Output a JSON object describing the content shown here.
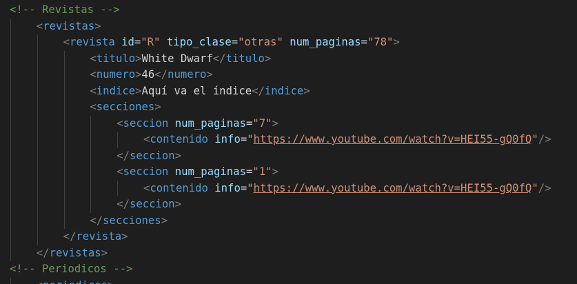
{
  "editor": {
    "language": "xml",
    "colors": {
      "background": "#1e1e1e",
      "comment": "#6a9955",
      "punctuation": "#808080",
      "tag": "#569cd6",
      "attribute": "#9cdcfe",
      "string": "#ce9178",
      "text": "#d4d4d4"
    },
    "lines": [
      {
        "indent": 0,
        "tokens": [
          {
            "k": "c",
            "v": "<!-- Revistas -->"
          }
        ]
      },
      {
        "indent": 1,
        "tokens": [
          {
            "k": "p",
            "v": "<"
          },
          {
            "k": "t",
            "v": "revistas"
          },
          {
            "k": "p",
            "v": ">"
          }
        ]
      },
      {
        "indent": 2,
        "tokens": [
          {
            "k": "p",
            "v": "<"
          },
          {
            "k": "t",
            "v": "revista"
          },
          {
            "k": "tx",
            "v": " "
          },
          {
            "k": "a",
            "v": "id"
          },
          {
            "k": "tx",
            "v": "="
          },
          {
            "k": "s",
            "v": "\"R\""
          },
          {
            "k": "tx",
            "v": " "
          },
          {
            "k": "a",
            "v": "tipo_clase"
          },
          {
            "k": "tx",
            "v": "="
          },
          {
            "k": "s",
            "v": "\"otras\""
          },
          {
            "k": "tx",
            "v": " "
          },
          {
            "k": "a",
            "v": "num_paginas"
          },
          {
            "k": "tx",
            "v": "="
          },
          {
            "k": "s",
            "v": "\"78\""
          },
          {
            "k": "p",
            "v": ">"
          }
        ]
      },
      {
        "indent": 3,
        "tokens": [
          {
            "k": "p",
            "v": "<"
          },
          {
            "k": "t",
            "v": "titulo"
          },
          {
            "k": "p",
            "v": ">"
          },
          {
            "k": "tx",
            "v": "White Dwarf"
          },
          {
            "k": "p",
            "v": "</"
          },
          {
            "k": "t",
            "v": "titulo"
          },
          {
            "k": "p",
            "v": ">"
          }
        ]
      },
      {
        "indent": 3,
        "tokens": [
          {
            "k": "p",
            "v": "<"
          },
          {
            "k": "t",
            "v": "numero"
          },
          {
            "k": "p",
            "v": ">"
          },
          {
            "k": "tx",
            "v": "46"
          },
          {
            "k": "p",
            "v": "</"
          },
          {
            "k": "t",
            "v": "numero"
          },
          {
            "k": "p",
            "v": ">"
          }
        ]
      },
      {
        "indent": 3,
        "tokens": [
          {
            "k": "p",
            "v": "<"
          },
          {
            "k": "t",
            "v": "indice"
          },
          {
            "k": "p",
            "v": ">"
          },
          {
            "k": "tx",
            "v": "Aquí va el índice"
          },
          {
            "k": "p",
            "v": "</"
          },
          {
            "k": "t",
            "v": "indice"
          },
          {
            "k": "p",
            "v": ">"
          }
        ]
      },
      {
        "indent": 3,
        "tokens": [
          {
            "k": "p",
            "v": "<"
          },
          {
            "k": "t",
            "v": "secciones"
          },
          {
            "k": "p",
            "v": ">"
          }
        ]
      },
      {
        "indent": 4,
        "tokens": [
          {
            "k": "p",
            "v": "<"
          },
          {
            "k": "t",
            "v": "seccion"
          },
          {
            "k": "tx",
            "v": " "
          },
          {
            "k": "a",
            "v": "num_paginas"
          },
          {
            "k": "tx",
            "v": "="
          },
          {
            "k": "s",
            "v": "\"7\""
          },
          {
            "k": "p",
            "v": ">"
          }
        ]
      },
      {
        "indent": 5,
        "tokens": [
          {
            "k": "p",
            "v": "<"
          },
          {
            "k": "t",
            "v": "contenido"
          },
          {
            "k": "tx",
            "v": " "
          },
          {
            "k": "a",
            "v": "info"
          },
          {
            "k": "tx",
            "v": "="
          },
          {
            "k": "s",
            "v": "\""
          },
          {
            "k": "lnk",
            "v": "https://www.youtube.com/watch?v=HEI55-gQ0fQ"
          },
          {
            "k": "s",
            "v": "\""
          },
          {
            "k": "p",
            "v": "/>"
          }
        ]
      },
      {
        "indent": 4,
        "tokens": [
          {
            "k": "p",
            "v": "</"
          },
          {
            "k": "t",
            "v": "seccion"
          },
          {
            "k": "p",
            "v": ">"
          }
        ]
      },
      {
        "indent": 4,
        "tokens": [
          {
            "k": "p",
            "v": "<"
          },
          {
            "k": "t",
            "v": "seccion"
          },
          {
            "k": "tx",
            "v": " "
          },
          {
            "k": "a",
            "v": "num_paginas"
          },
          {
            "k": "tx",
            "v": "="
          },
          {
            "k": "s",
            "v": "\"1\""
          },
          {
            "k": "p",
            "v": ">"
          }
        ]
      },
      {
        "indent": 5,
        "tokens": [
          {
            "k": "p",
            "v": "<"
          },
          {
            "k": "t",
            "v": "contenido"
          },
          {
            "k": "tx",
            "v": " "
          },
          {
            "k": "a",
            "v": "info"
          },
          {
            "k": "tx",
            "v": "="
          },
          {
            "k": "s",
            "v": "\""
          },
          {
            "k": "lnk",
            "v": "https://www.youtube.com/watch?v=HEI55-gQ0fQ"
          },
          {
            "k": "s",
            "v": "\""
          },
          {
            "k": "p",
            "v": "/>"
          }
        ]
      },
      {
        "indent": 4,
        "tokens": [
          {
            "k": "p",
            "v": "</"
          },
          {
            "k": "t",
            "v": "seccion"
          },
          {
            "k": "p",
            "v": ">"
          }
        ]
      },
      {
        "indent": 3,
        "tokens": [
          {
            "k": "p",
            "v": "</"
          },
          {
            "k": "t",
            "v": "secciones"
          },
          {
            "k": "p",
            "v": ">"
          }
        ]
      },
      {
        "indent": 2,
        "tokens": [
          {
            "k": "p",
            "v": "</"
          },
          {
            "k": "t",
            "v": "revista"
          },
          {
            "k": "p",
            "v": ">"
          }
        ]
      },
      {
        "indent": 1,
        "tokens": [
          {
            "k": "p",
            "v": "</"
          },
          {
            "k": "t",
            "v": "revistas"
          },
          {
            "k": "p",
            "v": ">"
          }
        ]
      },
      {
        "indent": 0,
        "tokens": [
          {
            "k": "c",
            "v": "<!-- Periodicos -->"
          }
        ]
      },
      {
        "indent": 1,
        "tokens": [
          {
            "k": "p",
            "v": "<"
          },
          {
            "k": "t",
            "v": "periodicos"
          },
          {
            "k": "p",
            "v": ">"
          }
        ]
      }
    ]
  }
}
